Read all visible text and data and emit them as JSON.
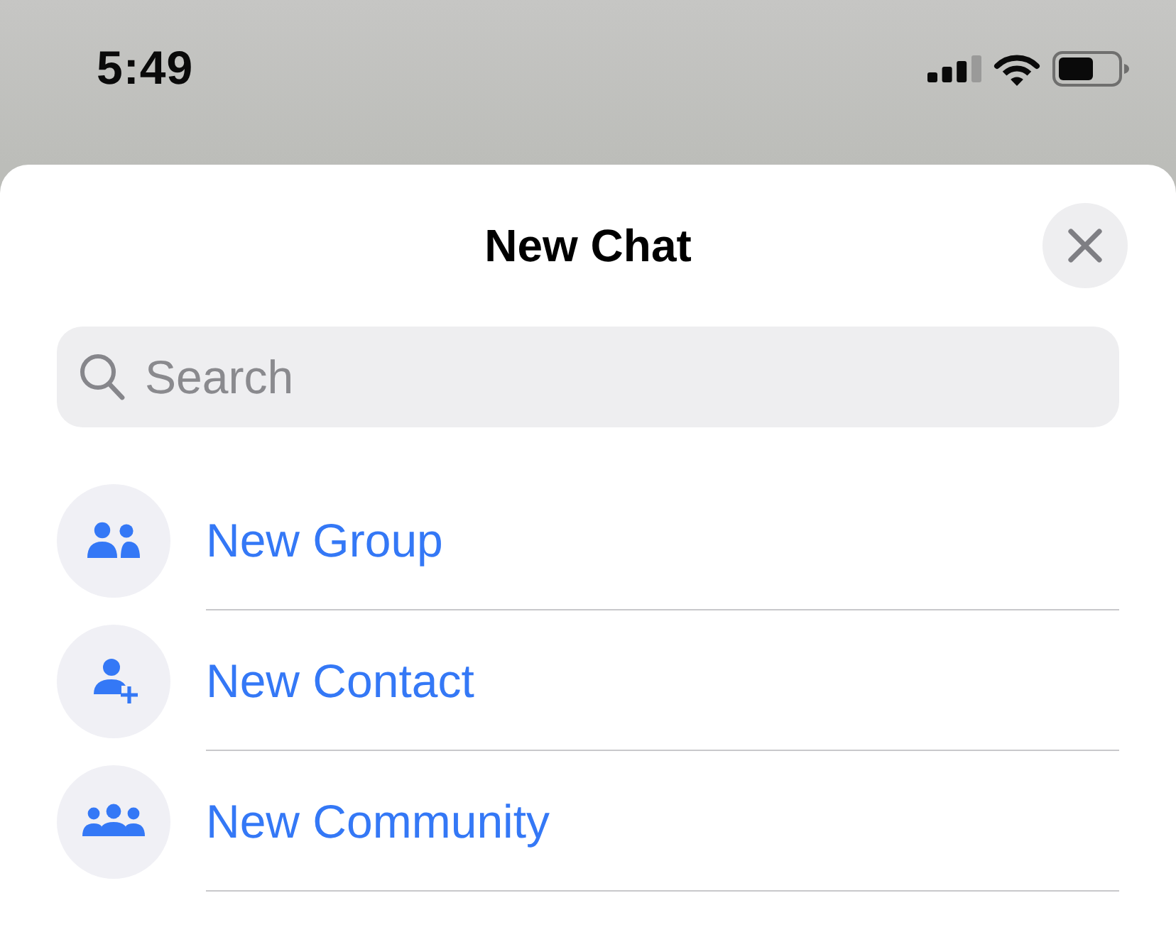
{
  "status_bar": {
    "time": "5:49"
  },
  "sheet": {
    "title": "New Chat",
    "search": {
      "placeholder": "Search"
    },
    "actions": [
      {
        "kind": "group",
        "label": "New Group"
      },
      {
        "kind": "contact",
        "label": "New Contact"
      },
      {
        "kind": "community",
        "label": "New Community"
      }
    ]
  }
}
